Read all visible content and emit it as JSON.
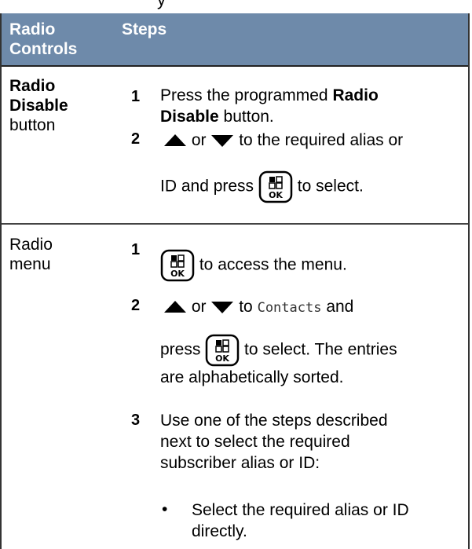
{
  "top_fragment": "y",
  "header": {
    "col1": "Radio\nControls",
    "col2": "Steps"
  },
  "rows": [
    {
      "control_bold": "Radio\nDisable",
      "control_rest": "button",
      "steps": [
        {
          "num": "1",
          "pre": "Press the programmed ",
          "bold": "Radio\nDisable",
          "post": " button."
        },
        {
          "num": "2",
          "or": "or",
          "text_a": "to the required alias or",
          "text_b": "ID and press",
          "text_c": "to select."
        }
      ]
    },
    {
      "control": "Radio\nmenu",
      "steps": [
        {
          "num": "1",
          "text": "to access the menu."
        },
        {
          "num": "2",
          "or": "or",
          "to": "to",
          "mono": "Contacts",
          "and": "and",
          "press": "press",
          "rest": "to select. The entries\nare alphabetically sorted."
        },
        {
          "num": "3",
          "text": "Use one of the steps described\nnext to select the required\nsubscriber alias or ID:"
        }
      ],
      "bullet": {
        "mark": "•",
        "text": "Select the required alias or ID\ndirectly."
      }
    }
  ],
  "icons": {
    "up": "up-arrow-icon",
    "down": "down-arrow-icon",
    "ok": "menu-ok-key-icon"
  }
}
